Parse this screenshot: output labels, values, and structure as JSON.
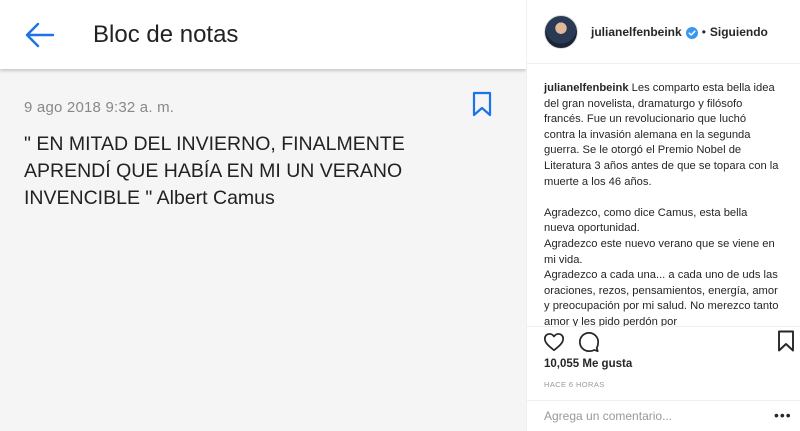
{
  "note": {
    "title": "Bloc de notas",
    "date": "9 ago 2018 9:32 a. m.",
    "quote": "\" EN MITAD DEL INVIERNO, FINALMENTE APRENDÍ QUE HABÍA EN MI UN VERANO INVENCIBLE \" Albert Camus"
  },
  "post": {
    "username": "julianelfenbeink",
    "separator": "•",
    "follow_status": "Siguiendo",
    "caption_user": "julianelfenbeink",
    "caption_first": "Les comparto esta bella idea del gran novelista, dramaturgo y filósofo francés. Fue un revolucionario que luchó contra la invasión alemana en la segunda guerra. Se le otorgó el Premio Nobel de Literatura 3 años antes de que se topara con la muerte a los 46 años.",
    "caption_p2": "Agradezco, como dice Camus, esta bella nueva oportunidad.",
    "caption_p3": "Agradezco este nuevo verano que se viene en mi vida.",
    "caption_p4": "Agradezco a cada una... a cada uno de uds las oraciones, rezos, pensamientos, energía, amor y preocupación por mi salud. No merezco tanto amor y les pido perdón por",
    "likes": "10,055 Me gusta",
    "time": "HACE 6 HORAS",
    "comment_placeholder": "Agrega un comentario...",
    "more": "•••"
  },
  "icons": {
    "back": "back-arrow-icon",
    "bookmark": "bookmark-icon",
    "heart": "heart-icon",
    "comment": "comment-icon",
    "verified": "verified-icon",
    "more": "more-icon"
  },
  "colors": {
    "accent": "#1a73e8",
    "verified": "#3897f0",
    "text": "#262626",
    "muted": "#999999"
  }
}
